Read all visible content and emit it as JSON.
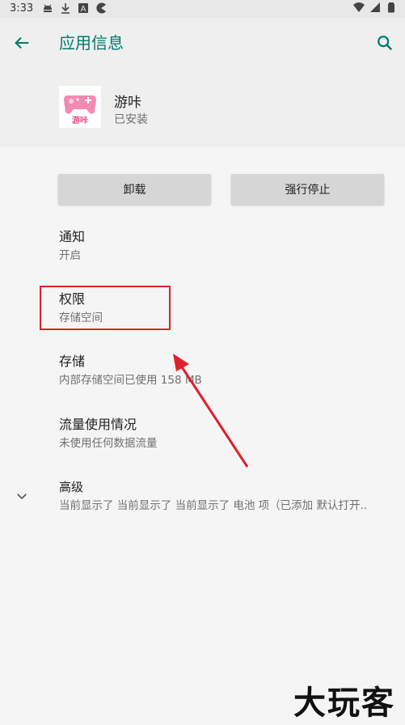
{
  "status_bar": {
    "time": "3:33",
    "left_icons": [
      "android-debug-icon",
      "download-icon",
      "a-icon",
      "pacman-icon"
    ],
    "right_icons": [
      "wifi-icon",
      "signal-icon",
      "battery-icon"
    ]
  },
  "header": {
    "title": "应用信息",
    "back_icon": "arrow-left-icon",
    "search_icon": "search-icon",
    "accent_color": "#00796b"
  },
  "app": {
    "name": "游咔",
    "status": "已安装",
    "icon_text": "游咔"
  },
  "buttons": {
    "uninstall": "卸载",
    "force_stop": "强行停止"
  },
  "items": [
    {
      "title": "通知",
      "subtitle": "开启"
    },
    {
      "title": "权限",
      "subtitle": "存储空间"
    },
    {
      "title": "存储",
      "subtitle": "内部存储空间已使用 158 MB"
    },
    {
      "title": "流量使用情况",
      "subtitle": "未使用任何数据流量"
    },
    {
      "title": "高级",
      "subtitle": "当前显示了 当前显示了 当前显示了 电池 项（已添加 默认打开.."
    }
  ],
  "annotation": {
    "highlight_color": "#e0202a"
  },
  "watermark": "大玩客"
}
